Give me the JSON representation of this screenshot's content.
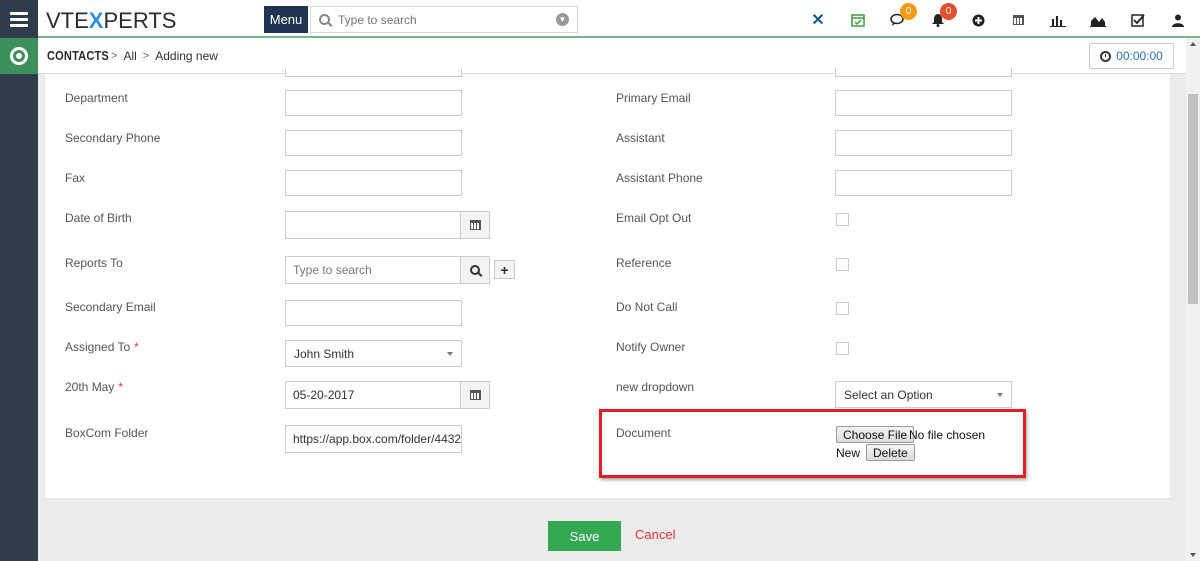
{
  "app": {
    "logo_left": "VTE",
    "logo_x": "X",
    "logo_right": "PERTS",
    "menu_label": "Menu"
  },
  "search": {
    "placeholder": "Type to search"
  },
  "header_icons": {
    "chat_badge": "0",
    "bell_badge": "0"
  },
  "breadcrumb": {
    "module": "CONTACTS",
    "sep1": ">",
    "filter": "All",
    "sep2": ">",
    "page": "Adding new"
  },
  "timer": {
    "value": "00:00:00"
  },
  "form": {
    "left": [
      {
        "label": "Department",
        "value": ""
      },
      {
        "label": "Secondary Phone",
        "value": ""
      },
      {
        "label": "Fax",
        "value": ""
      },
      {
        "label": "Date of Birth",
        "value": ""
      },
      {
        "label": "Reports To",
        "placeholder": "Type to search"
      },
      {
        "label": "Secondary Email",
        "value": ""
      },
      {
        "label": "Assigned To",
        "required": "*",
        "value": "John Smith"
      },
      {
        "label": "20th May",
        "required": "*",
        "value": "05-20-2017"
      },
      {
        "label": "BoxCom Folder",
        "value": "https://app.box.com/folder/4432"
      }
    ],
    "right": [
      {
        "label": "Primary Email",
        "value": ""
      },
      {
        "label": "Assistant",
        "value": ""
      },
      {
        "label": "Assistant Phone",
        "value": ""
      },
      {
        "label": "Email Opt Out"
      },
      {
        "label": "Reference"
      },
      {
        "label": "Do Not Call"
      },
      {
        "label": "Notify Owner"
      },
      {
        "label": "new dropdown",
        "value": "Select an Option"
      },
      {
        "label": "Document"
      }
    ],
    "document": {
      "choose_file": "Choose File",
      "no_file": "No file chosen",
      "new_label": "New",
      "delete_label": "Delete"
    }
  },
  "footer": {
    "save_label": "Save",
    "cancel_label": "Cancel"
  },
  "colors": {
    "rail": "#2f3d4a",
    "accent_green": "#35a854",
    "highlight_red": "#e21d25",
    "menu_navy": "#1e3450"
  }
}
